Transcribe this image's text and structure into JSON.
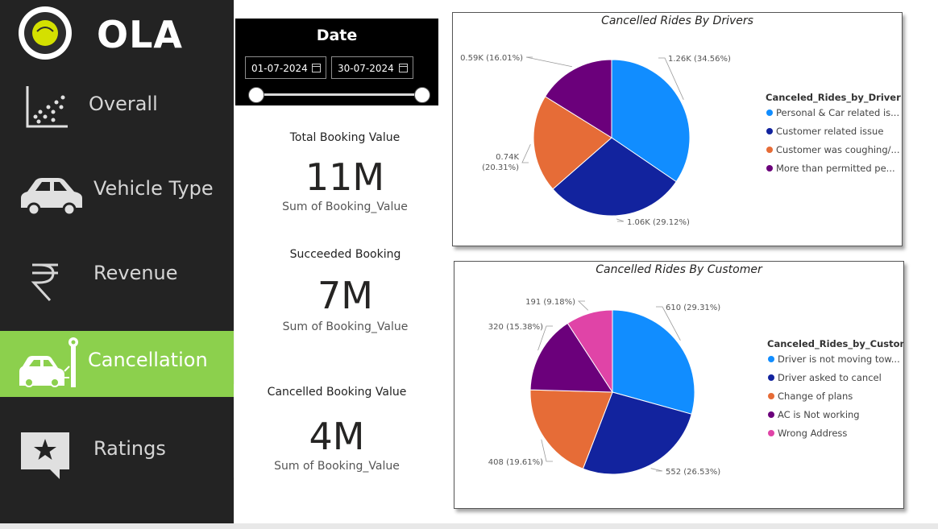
{
  "app": {
    "logo_text": "OLA"
  },
  "sidebar": {
    "items": [
      {
        "label": "Overall",
        "icon": "scatter-chart-icon",
        "active": false
      },
      {
        "label": "Vehicle Type",
        "icon": "car-icon",
        "active": false
      },
      {
        "label": "Revenue",
        "icon": "rupee-icon",
        "active": false
      },
      {
        "label": "Cancellation",
        "icon": "car-crash-icon",
        "active": true
      },
      {
        "label": "Ratings",
        "icon": "star-chat-icon",
        "active": false
      }
    ],
    "active_color": "#8cd04d",
    "background": "#232323"
  },
  "date_filter": {
    "title": "Date",
    "start": "01-07-2024",
    "end": "30-07-2024"
  },
  "cards": [
    {
      "title": "Total Booking Value",
      "value": "11M",
      "subtitle": "Sum of Booking_Value"
    },
    {
      "title": "Succeeded Booking",
      "value": "7M",
      "subtitle": "Sum of Booking_Value"
    },
    {
      "title": "Cancelled Booking Value",
      "value": "4M",
      "subtitle": "Sum of Booking_Value"
    }
  ],
  "chart_data": [
    {
      "type": "pie",
      "title": "Cancelled Rides By Drivers",
      "legend_title": "Canceled_Rides_by_Driver",
      "legend_position": "right",
      "slices": [
        {
          "legend": "Personal & Car related is...",
          "value": 1.26,
          "percent": 34.56,
          "label": "1.26K (34.56%)",
          "color": "#118dff"
        },
        {
          "legend": "Customer related issue",
          "value": 1.06,
          "percent": 29.12,
          "label": "1.06K (29.12%)",
          "color": "#12239e"
        },
        {
          "legend": "Customer was coughing/...",
          "value": 0.74,
          "percent": 20.31,
          "label_lines": [
            "0.74K",
            "(20.31%)"
          ],
          "color": "#e66c37"
        },
        {
          "legend": "More than permitted pe...",
          "value": 0.59,
          "percent": 16.01,
          "label": "0.59K (16.01%)",
          "color": "#6b007b"
        }
      ]
    },
    {
      "type": "pie",
      "title": "Cancelled Rides By Customer",
      "legend_title": "Canceled_Rides_by_Custom...",
      "legend_position": "right",
      "slices": [
        {
          "legend": "Driver is not moving tow...",
          "value": 610,
          "percent": 29.31,
          "label": "610 (29.31%)",
          "color": "#118dff"
        },
        {
          "legend": "Driver asked to cancel",
          "value": 552,
          "percent": 26.53,
          "label": "552 (26.53%)",
          "color": "#12239e"
        },
        {
          "legend": "Change of plans",
          "value": 408,
          "percent": 19.61,
          "label": "408 (19.61%)",
          "color": "#e66c37"
        },
        {
          "legend": "AC is Not working",
          "value": 320,
          "percent": 15.38,
          "label": "320 (15.38%)",
          "color": "#6b007b"
        },
        {
          "legend": "Wrong Address",
          "value": 191,
          "percent": 9.18,
          "label": "191 (9.18%)",
          "color": "#e044a7"
        }
      ]
    }
  ]
}
